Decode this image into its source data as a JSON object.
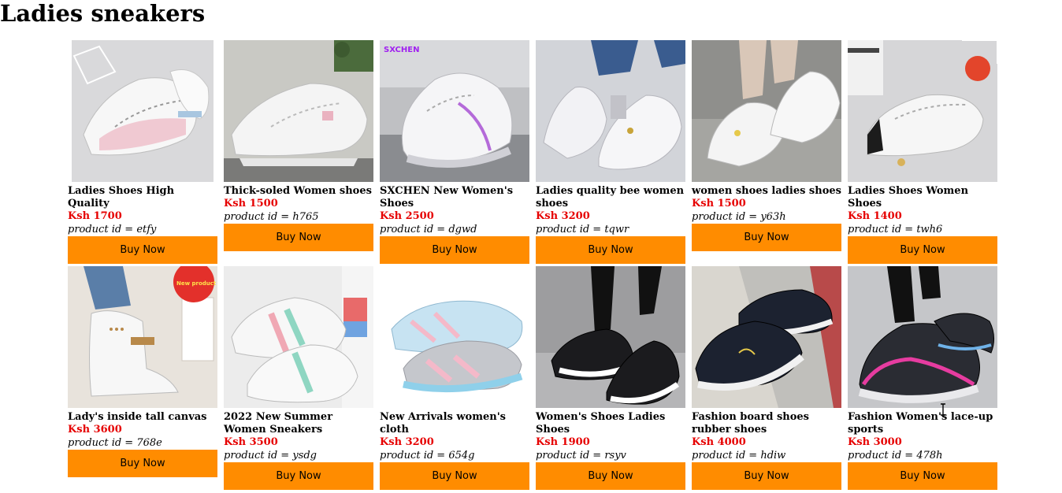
{
  "page": {
    "title": "Ladies sneakers"
  },
  "colors": {
    "price": "#e60000",
    "button_bg": "#ff8c00"
  },
  "products": [
    {
      "name": "Ladies Shoes High Quality",
      "price": "Ksh 1700",
      "pid": "product id = etfy",
      "button": "Buy Now",
      "image": "white-pink-sneaker-image"
    },
    {
      "name": "Thick-soled Women shoes",
      "price": "Ksh 1500",
      "pid": "product id = h765",
      "button": "Buy Now",
      "image": "white-sneaker-pair-image"
    },
    {
      "name": "SXCHEN New Women's Shoes",
      "price": "Ksh 2500",
      "pid": "product id = dgwd",
      "button": "Buy Now",
      "image": "white-chunky-sneaker-image"
    },
    {
      "name": "Ladies quality bee women shoes",
      "price": "Ksh 3200",
      "pid": "product id = tqwr",
      "button": "Buy Now",
      "image": "white-bee-sneaker-image"
    },
    {
      "name": "women shoes ladies shoes",
      "price": "Ksh 1500",
      "pid": "product id = y63h",
      "button": "Buy Now",
      "image": "white-worn-sneaker-image"
    },
    {
      "name": "Ladies Shoes Women Shoes",
      "price": "Ksh 1400",
      "pid": "product id = twh6",
      "button": "Buy Now",
      "image": "white-black-heel-sneaker-image"
    },
    {
      "name": "Lady's inside tall canvas",
      "price": "Ksh 3600",
      "pid": "product id = 768e",
      "button": "Buy Now",
      "image": "white-high-top-sneaker-image"
    },
    {
      "name": "2022 New Summer Women Sneakers",
      "price": "Ksh 3500",
      "pid": "product id = ysdg",
      "button": "Buy Now",
      "image": "pastel-stripe-sneaker-image"
    },
    {
      "name": "New Arrivals women's cloth",
      "price": "Ksh 3200",
      "pid": "product id = 654g",
      "button": "Buy Now",
      "image": "blue-pink-air-sneaker-image"
    },
    {
      "name": "Women's Shoes Ladies Shoes",
      "price": "Ksh 1900",
      "pid": "product id = rsyv",
      "button": "Buy Now",
      "image": "black-white-sneaker-image"
    },
    {
      "name": "Fashion board shoes rubber shoes",
      "price": "Ksh 4000",
      "pid": "product id = hdiw",
      "button": "Buy Now",
      "image": "black-canvas-sneaker-image"
    },
    {
      "name": "Fashion Women's lace-up sports",
      "price": "Ksh 3000",
      "pid": "product id = 478h",
      "button": "Buy Now",
      "image": "black-pink-sport-sneaker-image"
    }
  ],
  "badges": {
    "new_product": "New product",
    "brand": "SXCHEN"
  }
}
